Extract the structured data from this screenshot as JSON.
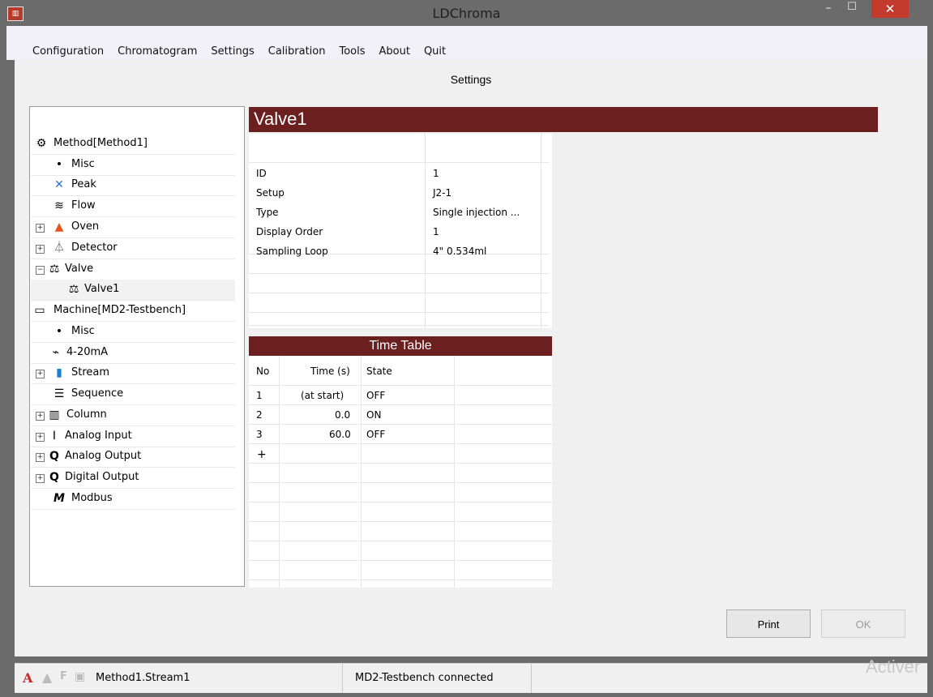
{
  "window": {
    "title": "LDChroma",
    "minimize": "–",
    "maximize": "☐",
    "close": "✕"
  },
  "menu": [
    "Configuration",
    "Chromatogram",
    "Settings",
    "Calibration",
    "Tools",
    "About",
    "Quit"
  ],
  "page_title": "Settings",
  "tree": [
    {
      "label": "Method[Method1]",
      "icon": "gears-icon",
      "glyph": "⚙",
      "expander": ""
    },
    {
      "label": "Misc",
      "icon": "bullet-icon",
      "glyph": "•",
      "expander": ""
    },
    {
      "label": "Peak",
      "icon": "peak-icon",
      "glyph": "✕",
      "expander": ""
    },
    {
      "label": "Flow",
      "icon": "flow-icon",
      "glyph": "≋",
      "expander": ""
    },
    {
      "label": "Oven",
      "icon": "flame-icon",
      "glyph": "🔥",
      "expander": "+"
    },
    {
      "label": "Detector",
      "icon": "detector-icon",
      "glyph": "⧍",
      "expander": "+"
    },
    {
      "label": "Valve",
      "icon": "valve-icon",
      "glyph": "⚖",
      "expander": "−"
    },
    {
      "label": "Valve1",
      "icon": "valve-icon",
      "glyph": "⚖",
      "expander": ""
    },
    {
      "label": "Machine[MD2-Testbench]",
      "icon": "machine-icon",
      "glyph": "▭",
      "expander": ""
    },
    {
      "label": "Misc",
      "icon": "bullet-icon",
      "glyph": "•",
      "expander": ""
    },
    {
      "label": "4-20mA",
      "icon": "resistor-icon",
      "glyph": "⌁",
      "expander": ""
    },
    {
      "label": "Stream",
      "icon": "bottle-icon",
      "glyph": "▮",
      "expander": "+"
    },
    {
      "label": "Sequence",
      "icon": "list-icon",
      "glyph": "☰",
      "expander": ""
    },
    {
      "label": "Column",
      "icon": "column-icon",
      "glyph": "▥",
      "expander": "+"
    },
    {
      "label": "Analog Input",
      "icon": "analog-input-icon",
      "glyph": "Ⅰ",
      "expander": "+"
    },
    {
      "label": "Analog Output",
      "icon": "analog-output-icon",
      "glyph": "Q",
      "expander": "+"
    },
    {
      "label": "Digital Output",
      "icon": "digital-output-icon",
      "glyph": "Q",
      "expander": "+"
    },
    {
      "label": "Modbus",
      "icon": "modbus-icon",
      "glyph": "M",
      "expander": ""
    }
  ],
  "panel": {
    "title": "Valve1",
    "properties": [
      {
        "name": "ID",
        "value": "1"
      },
      {
        "name": "Setup",
        "value": "J2-1"
      },
      {
        "name": "Type",
        "value": "Single injection ..."
      },
      {
        "name": "Display Order",
        "value": "1"
      },
      {
        "name": "Sampling Loop",
        "value": "4\" 0.534ml"
      }
    ]
  },
  "time_table": {
    "title": "Time Table",
    "headers": [
      "No",
      "Time (s)",
      "State"
    ],
    "rows": [
      [
        "1",
        "(at start)",
        "OFF"
      ],
      [
        "2",
        "0.0",
        "ON"
      ],
      [
        "3",
        "60.0",
        "OFF"
      ]
    ],
    "add_row": "+"
  },
  "buttons": {
    "print": "Print",
    "ok": "OK"
  },
  "status": {
    "method": "Method1.Stream1",
    "connection": "MD2-Testbench connected",
    "icon_a": "A",
    "icon_f": "F"
  },
  "watermark": "Activer"
}
